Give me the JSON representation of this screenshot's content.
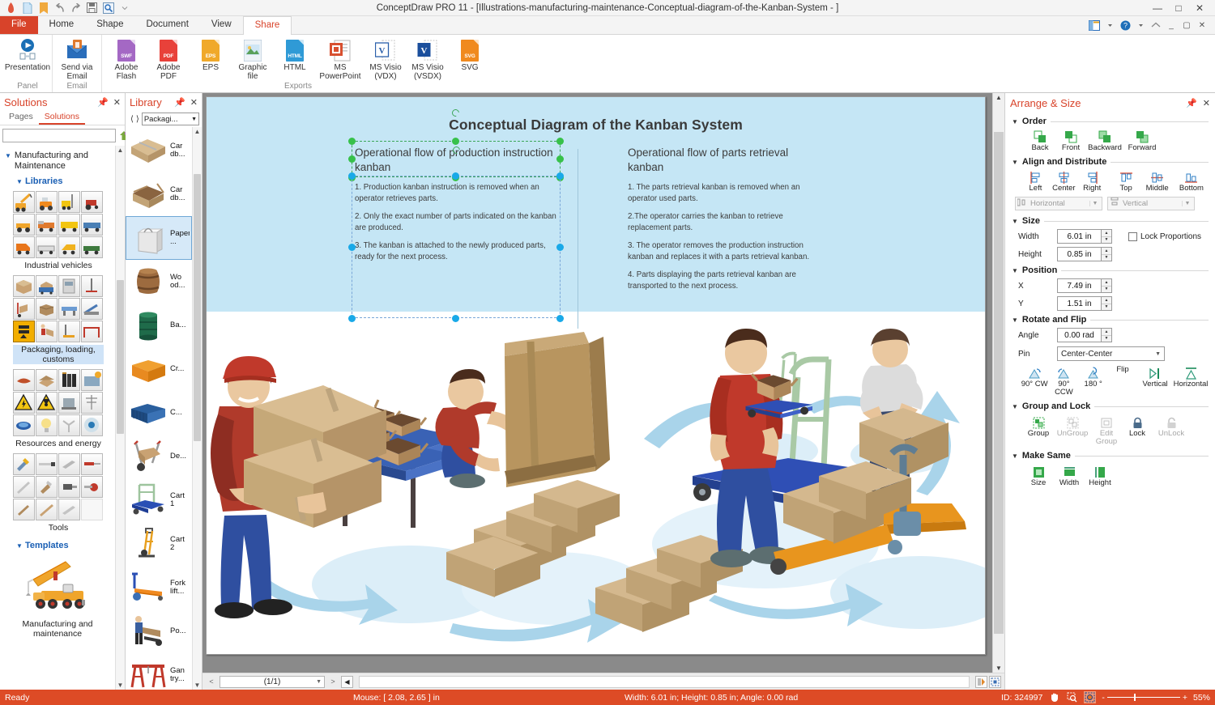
{
  "window": {
    "title": "ConceptDraw PRO 11 - [Illustrations-manufacturing-maintenance-Conceptual-diagram-of-the-Kanban-System -  ]",
    "quick_access": [
      "app-icon",
      "new-document-icon",
      "open-folder-icon",
      "undo-icon",
      "redo-icon",
      "save-icon",
      "preview-icon",
      "customize-caret-icon"
    ],
    "controls": [
      "minimize",
      "maximize",
      "close"
    ]
  },
  "ribbon": {
    "tabs": [
      {
        "label": "File",
        "style": "file"
      },
      {
        "label": "Home",
        "style": "normal"
      },
      {
        "label": "Shape",
        "style": "normal"
      },
      {
        "label": "Document",
        "style": "normal"
      },
      {
        "label": "View",
        "style": "normal"
      },
      {
        "label": "Share",
        "style": "active"
      }
    ],
    "right_icons": [
      "window-layout-icon",
      "help-icon",
      "cloud-icon",
      "minimize-ribbon-icon",
      "restore-icon",
      "close-ribbon-icon"
    ],
    "groups": [
      {
        "label": "Panel",
        "items": [
          {
            "label": "Presentation",
            "icon": "presentation-icon",
            "color": "#1b6fb5"
          }
        ]
      },
      {
        "label": "Email",
        "items": [
          {
            "label": "Send via Email",
            "icon": "send-email-icon",
            "color": "#2a6ebb"
          }
        ]
      },
      {
        "label": "Exports",
        "items": [
          {
            "label": "Adobe Flash",
            "icon": "swf-file-icon",
            "badge": "SWF",
            "color": "#a468c4"
          },
          {
            "label": "Adobe PDF",
            "icon": "pdf-file-icon",
            "badge": "PDF",
            "color": "#e8413a"
          },
          {
            "label": "EPS",
            "icon": "eps-file-icon",
            "badge": "EPS",
            "color": "#f0a92a"
          },
          {
            "label": "Graphic file",
            "icon": "image-file-icon",
            "badge": "",
            "color": "#8fb8d8"
          },
          {
            "label": "HTML",
            "icon": "html-file-icon",
            "badge": "HTML",
            "color": "#2f9ad6"
          },
          {
            "label": "MS PowerPoint",
            "icon": "powerpoint-file-icon",
            "badge": "",
            "color": "#d85030"
          },
          {
            "label": "MS Visio (VDX)",
            "icon": "visio-vdx-icon",
            "badge": "V",
            "color": "#2a5faa"
          },
          {
            "label": "MS Visio (VSDX)",
            "icon": "visio-vsdx-icon",
            "badge": "V",
            "color": "#1b4f9c"
          },
          {
            "label": "SVG",
            "icon": "svg-file-icon",
            "badge": "SVG",
            "color": "#f08a1e"
          }
        ]
      }
    ]
  },
  "solutions_panel": {
    "title": "Solutions",
    "pin_icon": "pin-icon",
    "close_icon": "close-icon",
    "tabs": [
      {
        "label": "Pages",
        "active": false
      },
      {
        "label": "Solutions",
        "active": true
      }
    ],
    "search": {
      "value": "",
      "placeholder": ""
    },
    "search_button_icon": "solution-park-icon",
    "group": "Manufacturing and Maintenance",
    "libraries_label": "Libraries",
    "templates_label": "Templates",
    "stencils": [
      {
        "name": "Industrial vehicles",
        "selected": false
      },
      {
        "name": "Packaging, loading, customs",
        "selected": true
      },
      {
        "name": "Resources and energy",
        "selected": false
      },
      {
        "name": "Tools",
        "selected": false
      }
    ],
    "template": {
      "name": "Manufacturing and maintenance"
    }
  },
  "library_panel": {
    "title": "Library",
    "pin_icon": "pin-icon",
    "close_icon": "close-icon",
    "prev_icon": "prev-arrow-icon",
    "next_icon": "next-arrow-icon",
    "selected_library": "Packagi...",
    "items": [
      {
        "name": "Car db...",
        "icon": "closed-cardboard-box-icon",
        "selected": false
      },
      {
        "name": "Car db...",
        "icon": "open-cardboard-box-icon",
        "selected": false
      },
      {
        "name": "Paper ...",
        "icon": "paper-bag-icon",
        "selected": true
      },
      {
        "name": "Wo od...",
        "icon": "wooden-barrel-icon",
        "selected": false
      },
      {
        "name": "Ba...",
        "icon": "metal-barrel-icon",
        "selected": false
      },
      {
        "name": "Cr...",
        "icon": "plastic-crate-icon",
        "selected": false
      },
      {
        "name": "C...",
        "icon": "shipping-container-icon",
        "selected": false
      },
      {
        "name": "De...",
        "icon": "hand-truck-icon",
        "selected": false
      },
      {
        "name": "Cart 1",
        "icon": "platform-cart-icon",
        "selected": false
      },
      {
        "name": "Cart 2",
        "icon": "sack-truck-icon",
        "selected": false
      },
      {
        "name": "Fork lift...",
        "icon": "pallet-jack-icon",
        "selected": false
      },
      {
        "name": "Po...",
        "icon": "porter-icon",
        "selected": false
      },
      {
        "name": "Gan try...",
        "icon": "gantry-crane-icon",
        "selected": false
      }
    ]
  },
  "canvas": {
    "diagram_title": "Conceptual Diagram of the Kanban System",
    "left_column": {
      "heading": "Operational flow of production instruction kanban",
      "paragraphs": [
        "1. Production kanban instruction is removed when an operator retrieves parts.",
        "2. Only the exact number of parts indicated on the kanban are produced.",
        "3. The kanban is attached to the newly produced parts, ready for the next process."
      ]
    },
    "right_column": {
      "heading": "Operational flow of parts retrieval kanban",
      "paragraphs": [
        "1. The parts retrieval kanban is removed when an operator used parts.",
        "2.The operator carries the kanban to retrieve replacement parts.",
        "3. The operator removes the production instruction kanban and replaces it with a parts retrieval kanban.",
        "4. Parts displaying the parts retrieval kanban are transported to the next process."
      ]
    }
  },
  "page_nav": {
    "prev_label": "<",
    "page_indicator": "(1/1)",
    "next_label": ">",
    "first_icon": "first-page-icon",
    "right_icons": [
      "show-preview-icon",
      "fit-page-icon"
    ]
  },
  "arrange_panel": {
    "title": "Arrange & Size",
    "pin_icon": "pin-icon",
    "close_icon": "close-icon",
    "sections": {
      "order": {
        "label": "Order",
        "buttons": [
          {
            "label": "Back",
            "icon": "send-to-back-icon"
          },
          {
            "label": "Front",
            "icon": "bring-to-front-icon"
          },
          {
            "label": "Backward",
            "icon": "send-backward-icon"
          },
          {
            "label": "Forward",
            "icon": "bring-forward-icon"
          }
        ]
      },
      "align": {
        "label": "Align and Distribute",
        "buttons": [
          {
            "label": "Left",
            "icon": "align-left-icon"
          },
          {
            "label": "Center",
            "icon": "align-center-icon"
          },
          {
            "label": "Right",
            "icon": "align-right-icon"
          },
          {
            "label": "Top",
            "icon": "align-top-icon"
          },
          {
            "label": "Middle",
            "icon": "align-middle-icon"
          },
          {
            "label": "Bottom",
            "icon": "align-bottom-icon"
          }
        ],
        "distribute": [
          {
            "label": "Horizontal",
            "icon": "distribute-horizontal-icon"
          },
          {
            "label": "Vertical",
            "icon": "distribute-vertical-icon"
          }
        ]
      },
      "size": {
        "label": "Size",
        "width_label": "Width",
        "width_value": "6.01 in",
        "height_label": "Height",
        "height_value": "0.85 in",
        "lock_label": "Lock Proportions",
        "lock_checked": false
      },
      "position": {
        "label": "Position",
        "x_label": "X",
        "x_value": "7.49 in",
        "y_label": "Y",
        "y_value": "1.51 in"
      },
      "rotate": {
        "label": "Rotate and Flip",
        "angle_label": "Angle",
        "angle_value": "0.00 rad",
        "pin_label": "Pin",
        "pin_value": "Center-Center",
        "buttons": [
          {
            "label": "90° CW",
            "icon": "rotate-cw-icon"
          },
          {
            "label": "90° CCW",
            "icon": "rotate-ccw-icon"
          },
          {
            "label": "180 °",
            "icon": "rotate-180-icon"
          },
          {
            "label": "Flip",
            "icon": "flip-label"
          },
          {
            "label": "Vertical",
            "icon": "flip-vertical-icon"
          },
          {
            "label": "Horizontal",
            "icon": "flip-horizontal-icon"
          }
        ]
      },
      "group": {
        "label": "Group and Lock",
        "buttons": [
          {
            "label": "Group",
            "icon": "group-icon"
          },
          {
            "label": "UnGroup",
            "icon": "ungroup-icon"
          },
          {
            "label": "Edit Group",
            "icon": "edit-group-icon"
          },
          {
            "label": "Lock",
            "icon": "lock-icon"
          },
          {
            "label": "UnLock",
            "icon": "unlock-icon"
          }
        ]
      },
      "makesame": {
        "label": "Make Same",
        "buttons": [
          {
            "label": "Size",
            "icon": "same-size-icon"
          },
          {
            "label": "Width",
            "icon": "same-width-icon"
          },
          {
            "label": "Height",
            "icon": "same-height-icon"
          }
        ]
      }
    }
  },
  "status_bar": {
    "ready": "Ready",
    "mouse": "Mouse: [ 2.08, 2.65 ] in",
    "dims": "Width: 6.01 in;  Height: 0.85 in;  Angle: 0.00 rad",
    "object_id": "ID: 324997",
    "tools": [
      "hand-tool-icon",
      "zoom-tool-icon",
      "selection-tool-icon"
    ],
    "zoom_minus": "-",
    "zoom_plus": "+",
    "zoom_value": "55%"
  },
  "colors": {
    "accent": "#d8432a",
    "status_bar": "#dd4b26",
    "sky": "#c5e6f5",
    "selection_green": "#37c14a",
    "selection_blue": "#19a9e8"
  }
}
